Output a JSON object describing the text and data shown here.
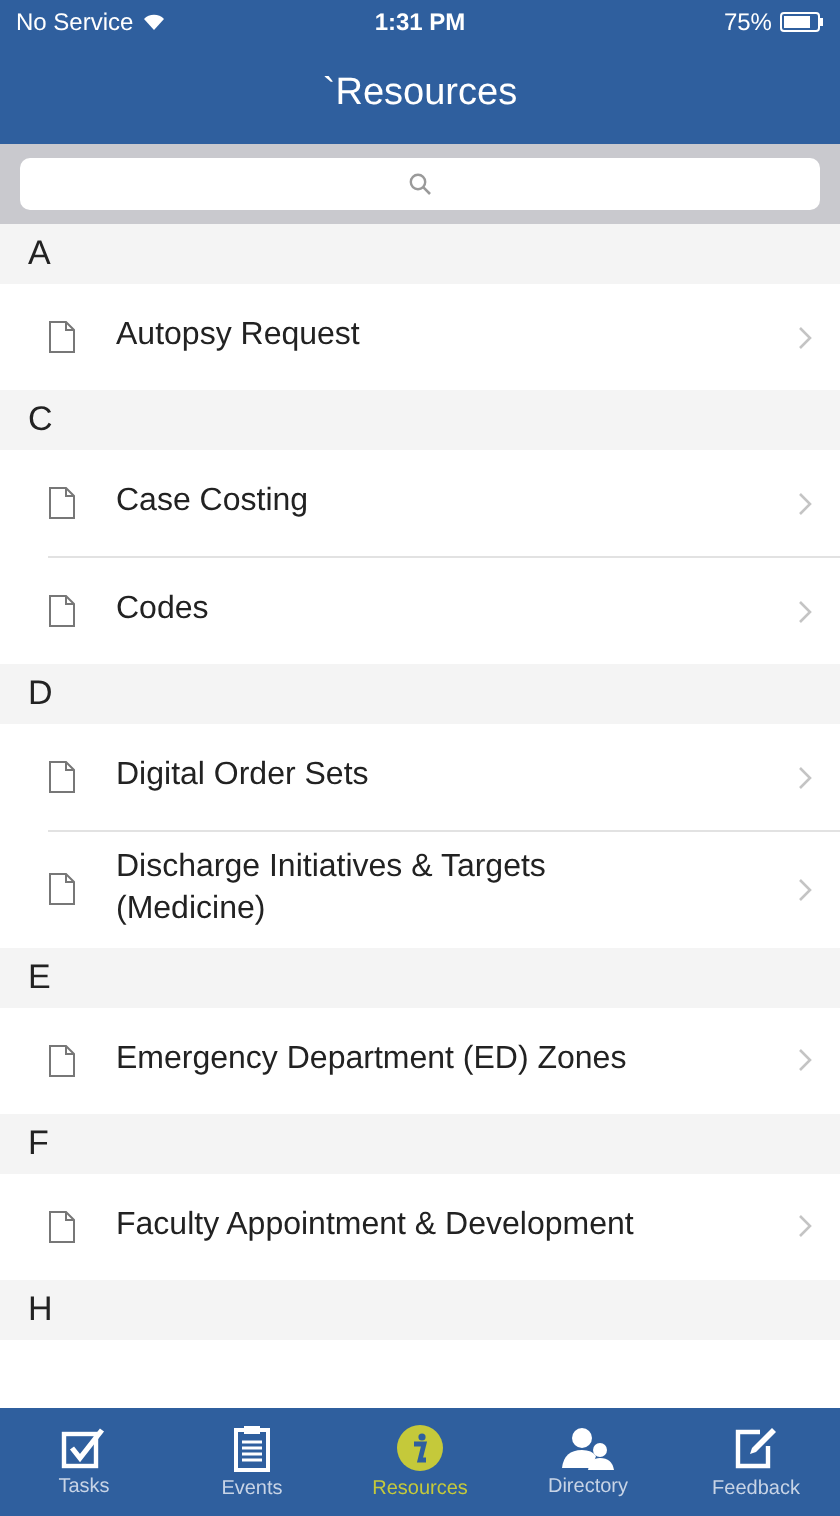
{
  "status_bar": {
    "carrier": "No Service",
    "time": "1:31 PM",
    "battery": "75%"
  },
  "nav": {
    "title": "`Resources"
  },
  "sections": [
    {
      "letter": "A",
      "items": [
        {
          "title": "Autopsy Request"
        }
      ]
    },
    {
      "letter": "C",
      "items": [
        {
          "title": "Case Costing"
        },
        {
          "title": "Codes"
        }
      ]
    },
    {
      "letter": "D",
      "items": [
        {
          "title": "Digital Order Sets"
        },
        {
          "title": "Discharge Initiatives & Targets (Medicine)"
        }
      ]
    },
    {
      "letter": "E",
      "items": [
        {
          "title": "Emergency Department (ED) Zones"
        }
      ]
    },
    {
      "letter": "F",
      "items": [
        {
          "title": "Faculty Appointment & Development"
        }
      ]
    },
    {
      "letter": "H"
    }
  ],
  "tabs": [
    {
      "label": "Tasks",
      "selected": false
    },
    {
      "label": "Events",
      "selected": false
    },
    {
      "label": "Resources",
      "selected": true
    },
    {
      "label": "Directory",
      "selected": false
    },
    {
      "label": "Feedback",
      "selected": false
    }
  ]
}
